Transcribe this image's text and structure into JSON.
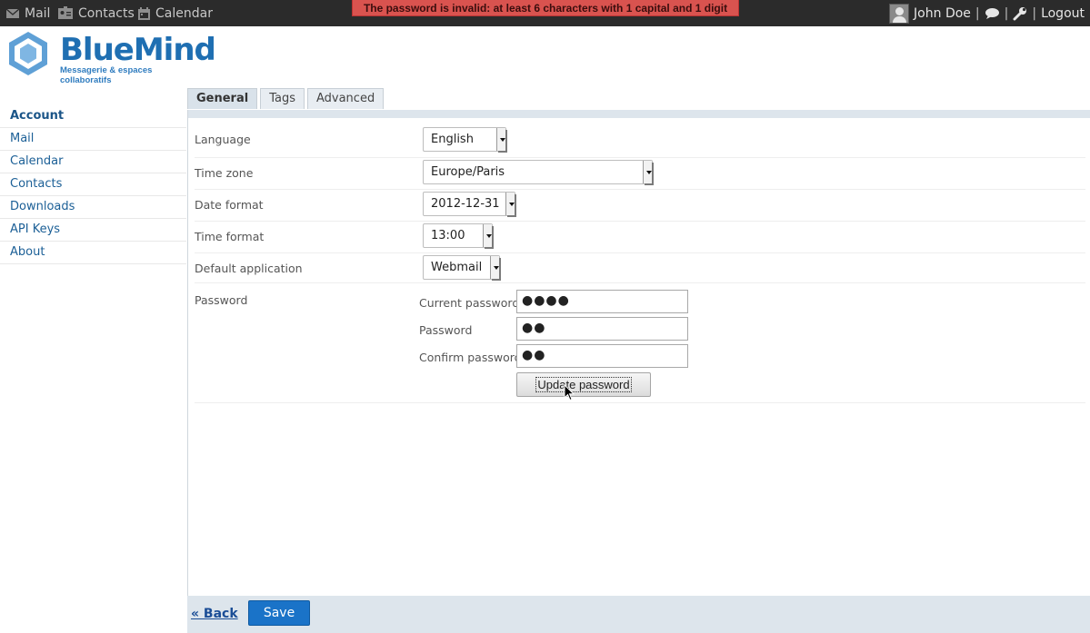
{
  "topbar": {
    "apps": [
      {
        "label": "Mail",
        "icon": "mail-icon"
      },
      {
        "label": "Contacts",
        "icon": "contacts-icon"
      },
      {
        "label": "Calendar",
        "icon": "calendar-icon"
      }
    ],
    "alert": "The password is invalid: at least 6 characters with 1 capital and 1 digit",
    "user_name": "John Doe",
    "logout": "Logout"
  },
  "logo": {
    "name": "BlueMind",
    "tagline": "Messagerie & espaces collaboratifs"
  },
  "sidebar": {
    "items": [
      {
        "label": "Account",
        "active": true
      },
      {
        "label": "Mail"
      },
      {
        "label": "Calendar"
      },
      {
        "label": "Contacts"
      },
      {
        "label": "Downloads"
      },
      {
        "label": "API Keys"
      },
      {
        "label": "About"
      }
    ]
  },
  "tabs": [
    {
      "label": "General",
      "active": true
    },
    {
      "label": "Tags"
    },
    {
      "label": "Advanced"
    }
  ],
  "form": {
    "language": {
      "label": "Language",
      "value": "English"
    },
    "timezone": {
      "label": "Time zone",
      "value": "Europe/Paris"
    },
    "date_format": {
      "label": "Date format",
      "value": "2012-12-31"
    },
    "time_format": {
      "label": "Time format",
      "value": "13:00"
    },
    "default_app": {
      "label": "Default application",
      "value": "Webmail"
    },
    "password": {
      "label": "Password",
      "current_label": "Current password",
      "current_value": "●●●●",
      "new_label": "Password",
      "new_value": "●●",
      "confirm_label": "Confirm password",
      "confirm_value": "●●",
      "update_button": "Update password"
    }
  },
  "footer": {
    "back": "« Back",
    "save": "Save"
  },
  "colors": {
    "alert_bg": "#d9534f",
    "brand": "#1f6fb2",
    "save_button": "#1a73c8"
  }
}
